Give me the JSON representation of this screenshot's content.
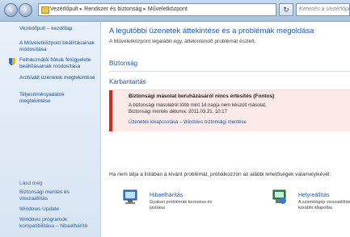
{
  "address_bar": {
    "path": [
      "Vezérlőpult",
      "Rendszer és biztonság",
      "Műveletközpont"
    ],
    "search_placeholder": "Keresés a Vezérlőpulton"
  },
  "sidebar": {
    "home": "Vezérlőpult – kezdőlap",
    "links": [
      "A Műveletközpont beállításainak módosítása",
      "Felhasználói fiókok felügyelete beállításainak módosítása",
      "Archivált üzenetek megtekintése",
      "Teljesítményadatok megtekintése"
    ],
    "see_also": "Lásd még",
    "bottom_links": [
      "Biztonsági mentés és visszaállítás",
      "Windows Update",
      "Windows programok kompatibilitása – hibaelhárító"
    ]
  },
  "main": {
    "title": "A legutóbbi üzenetek áttekintése és a problémák megoldása",
    "subtitle": "A Műveletközpont legalább egy, áttekintendő problémát észlelt.",
    "sections": {
      "security": "Biztonság",
      "maintenance": "Karbantartás"
    },
    "alert": {
      "title": "Biztonsági másolat beruházásáról nincs értesítés (Fontos)",
      "line1": "A biztonsági másolatról több mint 14 napja nem készült másolat.",
      "line2": "Biztonsági mentés dátuma: 2011.03.21. 10:17",
      "links": "Üzenetek kikapcsolása – Windows biztonsági mentése"
    },
    "hint": "Ha nem látja a listában a kívánt problémát, próbálkozzon az alábbi lehetőségek valamelyikével:",
    "tiles": [
      {
        "label": "Hibaelhárítás",
        "desc": "Gyakori problémák keresése és javítása"
      },
      {
        "label": "Helyreállítás",
        "desc": "A számítógép visszaállítása korábbi állapotba"
      }
    ]
  },
  "colors": {
    "link": "#1e5aa8",
    "alert_red": "#d9261c",
    "alert_bg": "#fbeae8"
  }
}
